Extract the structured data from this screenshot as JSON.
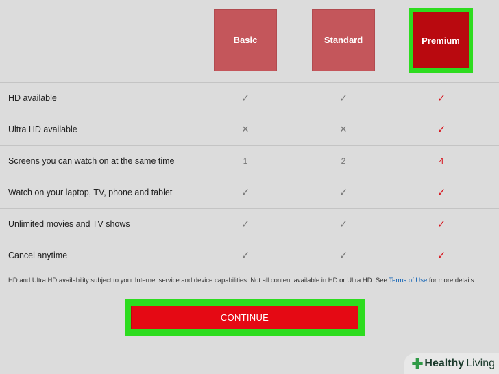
{
  "plans": [
    {
      "name": "Basic"
    },
    {
      "name": "Standard"
    },
    {
      "name": "Premium"
    }
  ],
  "features": [
    {
      "label": "HD available",
      "values": [
        "check",
        "check",
        "check"
      ]
    },
    {
      "label": "Ultra HD available",
      "values": [
        "cross",
        "cross",
        "check"
      ]
    },
    {
      "label": "Screens you can watch on at the same time",
      "values": [
        "1",
        "2",
        "4"
      ]
    },
    {
      "label": "Watch on your laptop, TV, phone and tablet",
      "values": [
        "check",
        "check",
        "check"
      ]
    },
    {
      "label": "Unlimited movies and TV shows",
      "values": [
        "check",
        "check",
        "check"
      ]
    },
    {
      "label": "Cancel anytime",
      "values": [
        "check",
        "check",
        "check"
      ]
    }
  ],
  "footnote": {
    "text_before": "HD and Ultra HD availability subject to your Internet service and device capabilities. Not all content available in HD or Ultra HD. See ",
    "link": "Terms of Use",
    "text_after": " for more details."
  },
  "continue_label": "CONTINUE",
  "watermark": {
    "word1": "Healthy",
    "word2": "Living"
  },
  "colors": {
    "background": "#dcdcdc",
    "plan_inactive": "#c4565b",
    "plan_selected": "#b9090f",
    "highlight": "#2ddc1f",
    "cta": "#e50914",
    "premium_mark": "#d8111a",
    "link": "#0b5fb4"
  }
}
